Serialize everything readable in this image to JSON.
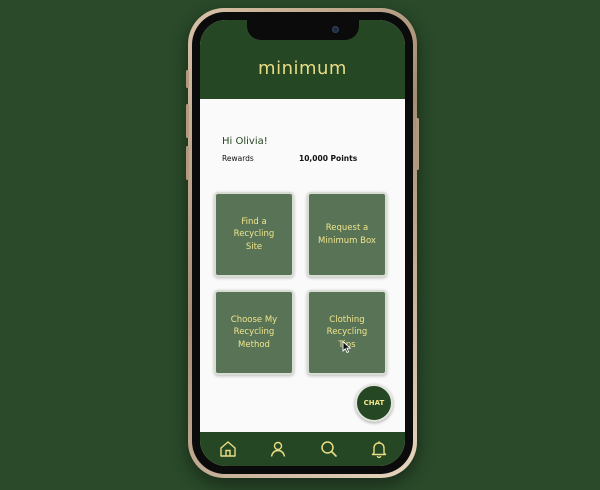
{
  "app": {
    "logo_text": "minimum",
    "brand_color": "#264724",
    "accent_color": "#e9dd84",
    "tile_color": "#587356"
  },
  "home": {
    "greeting": "Hi Olivia!",
    "rewards_label": "Rewards",
    "rewards_points": "10,000 Points"
  },
  "tiles": [
    {
      "label": "Find a\nRecycling\nSite"
    },
    {
      "label": "Request a\nMinimum Box"
    },
    {
      "label": "Choose  My\nRecycling\nMethod"
    },
    {
      "label": "Clothing\nRecycling\nTips"
    }
  ],
  "chat": {
    "label": "CHAT"
  },
  "navbar": {
    "items": [
      {
        "icon": "home-icon"
      },
      {
        "icon": "profile-icon"
      },
      {
        "icon": "search-icon"
      },
      {
        "icon": "bell-icon"
      }
    ]
  }
}
